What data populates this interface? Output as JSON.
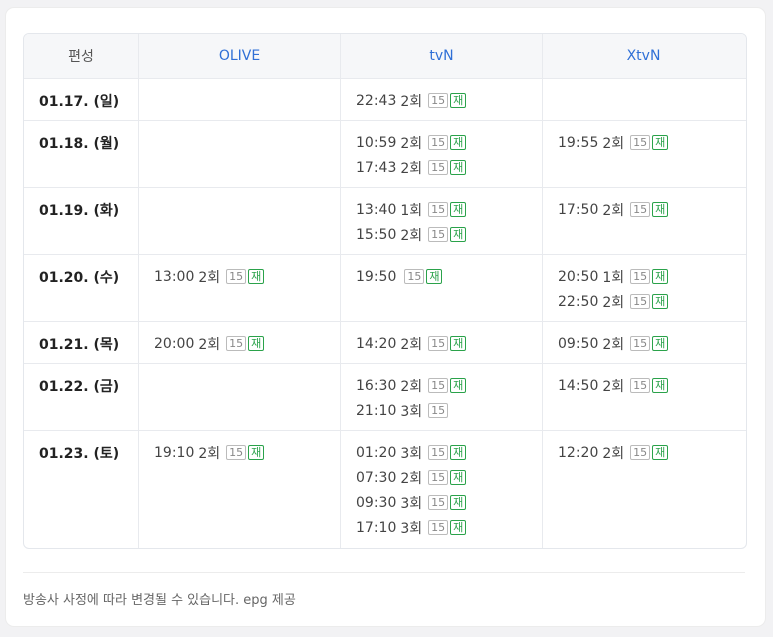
{
  "header": {
    "date_col": "편성",
    "channels": [
      "OLIVE",
      "tvN",
      "XtvN"
    ]
  },
  "rows": [
    {
      "date": "01.17. (일)",
      "cells": [
        [],
        [
          {
            "time": "22:43",
            "ep": "2회",
            "age": "15",
            "re": "재"
          }
        ],
        []
      ]
    },
    {
      "date": "01.18. (월)",
      "cells": [
        [],
        [
          {
            "time": "10:59",
            "ep": "2회",
            "age": "15",
            "re": "재"
          },
          {
            "time": "17:43",
            "ep": "2회",
            "age": "15",
            "re": "재"
          }
        ],
        [
          {
            "time": "19:55",
            "ep": "2회",
            "age": "15",
            "re": "재"
          }
        ]
      ]
    },
    {
      "date": "01.19. (화)",
      "cells": [
        [],
        [
          {
            "time": "13:40",
            "ep": "1회",
            "age": "15",
            "re": "재"
          },
          {
            "time": "15:50",
            "ep": "2회",
            "age": "15",
            "re": "재"
          }
        ],
        [
          {
            "time": "17:50",
            "ep": "2회",
            "age": "15",
            "re": "재"
          }
        ]
      ]
    },
    {
      "date": "01.20. (수)",
      "cells": [
        [
          {
            "time": "13:00",
            "ep": "2회",
            "age": "15",
            "re": "재"
          }
        ],
        [
          {
            "time": "19:50",
            "ep": "",
            "age": "15",
            "re": "재"
          }
        ],
        [
          {
            "time": "20:50",
            "ep": "1회",
            "age": "15",
            "re": "재"
          },
          {
            "time": "22:50",
            "ep": "2회",
            "age": "15",
            "re": "재"
          }
        ]
      ]
    },
    {
      "date": "01.21. (목)",
      "cells": [
        [
          {
            "time": "20:00",
            "ep": "2회",
            "age": "15",
            "re": "재"
          }
        ],
        [
          {
            "time": "14:20",
            "ep": "2회",
            "age": "15",
            "re": "재"
          }
        ],
        [
          {
            "time": "09:50",
            "ep": "2회",
            "age": "15",
            "re": "재"
          }
        ]
      ]
    },
    {
      "date": "01.22. (금)",
      "cells": [
        [],
        [
          {
            "time": "16:30",
            "ep": "2회",
            "age": "15",
            "re": "재"
          },
          {
            "time": "21:10",
            "ep": "3회",
            "age": "15",
            "re": ""
          }
        ],
        [
          {
            "time": "14:50",
            "ep": "2회",
            "age": "15",
            "re": "재"
          }
        ]
      ]
    },
    {
      "date": "01.23. (토)",
      "cells": [
        [
          {
            "time": "19:10",
            "ep": "2회",
            "age": "15",
            "re": "재"
          }
        ],
        [
          {
            "time": "01:20",
            "ep": "3회",
            "age": "15",
            "re": "재"
          },
          {
            "time": "07:30",
            "ep": "2회",
            "age": "15",
            "re": "재"
          },
          {
            "time": "09:30",
            "ep": "3회",
            "age": "15",
            "re": "재"
          },
          {
            "time": "17:10",
            "ep": "3회",
            "age": "15",
            "re": "재"
          }
        ],
        [
          {
            "time": "12:20",
            "ep": "2회",
            "age": "15",
            "re": "재"
          }
        ]
      ]
    }
  ],
  "footer": {
    "note": "방송사 사정에 따라 변경될 수 있습니다. epg 제공"
  }
}
